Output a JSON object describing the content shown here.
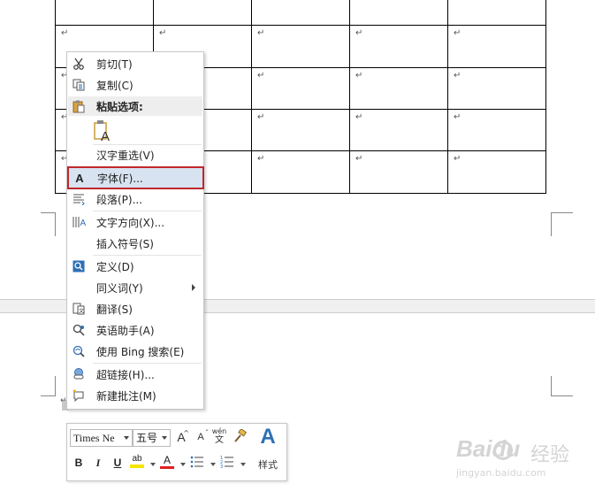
{
  "document": {
    "paragraph_mark": "↵",
    "table_rows": 5,
    "table_cols": 5
  },
  "context_menu": {
    "items": [
      {
        "name": "cut",
        "icon": "scissors-icon",
        "label": "剪切(T)"
      },
      {
        "name": "copy",
        "icon": "copy-icon",
        "label": "复制(C)"
      },
      {
        "name": "paste-options",
        "icon": "clipboard-icon",
        "label": "粘贴选项:"
      },
      {
        "name": "paste-text-only",
        "icon": "paste-text-only-icon",
        "label": ""
      },
      {
        "name": "reconvert",
        "icon": "",
        "label": "汉字重选(V)"
      },
      {
        "name": "font",
        "icon": "font-a-icon",
        "icon_text": "A",
        "label": "字体(F)..."
      },
      {
        "name": "paragraph",
        "icon": "paragraph-icon",
        "label": "段落(P)..."
      },
      {
        "name": "text-direction",
        "icon": "text-direction-icon",
        "label": "文字方向(X)..."
      },
      {
        "name": "insert-symbol",
        "icon": "",
        "label": "插入符号(S)"
      },
      {
        "name": "define",
        "icon": "define-icon",
        "label": "定义(D)"
      },
      {
        "name": "synonyms",
        "icon": "",
        "label": "同义词(Y)"
      },
      {
        "name": "translate",
        "icon": "translate-icon",
        "label": "翻译(S)"
      },
      {
        "name": "english-assistant",
        "icon": "english-assistant-icon",
        "label": "英语助手(A)"
      },
      {
        "name": "bing-search",
        "icon": "bing-search-icon",
        "label": "使用 Bing 搜索(E)"
      },
      {
        "name": "hyperlink",
        "icon": "hyperlink-icon",
        "label": "超链接(H)..."
      },
      {
        "name": "new-comment",
        "icon": "new-comment-icon",
        "label": "新建批注(M)"
      }
    ]
  },
  "mini_toolbar": {
    "font_name": "Times Ne",
    "font_size": "五号",
    "grow_font": "A",
    "shrink_font": "A",
    "phonetic_top": "wén",
    "phonetic_bottom": "文",
    "bold": "B",
    "italic": "I",
    "underline": "U",
    "highlight": "ab",
    "font_color": "A",
    "styles_icon": "A",
    "styles_label": "样式",
    "highlight_color": "#f5e400",
    "font_color_value": "#e02020",
    "accent": "#2f6fb5"
  },
  "watermark": {
    "brand": "Baidu",
    "suffix": "经验",
    "url": "jingyan.baidu.com"
  },
  "colors": {
    "menu_highlight": "#d7e3f0",
    "callout_border": "#c0282e"
  }
}
